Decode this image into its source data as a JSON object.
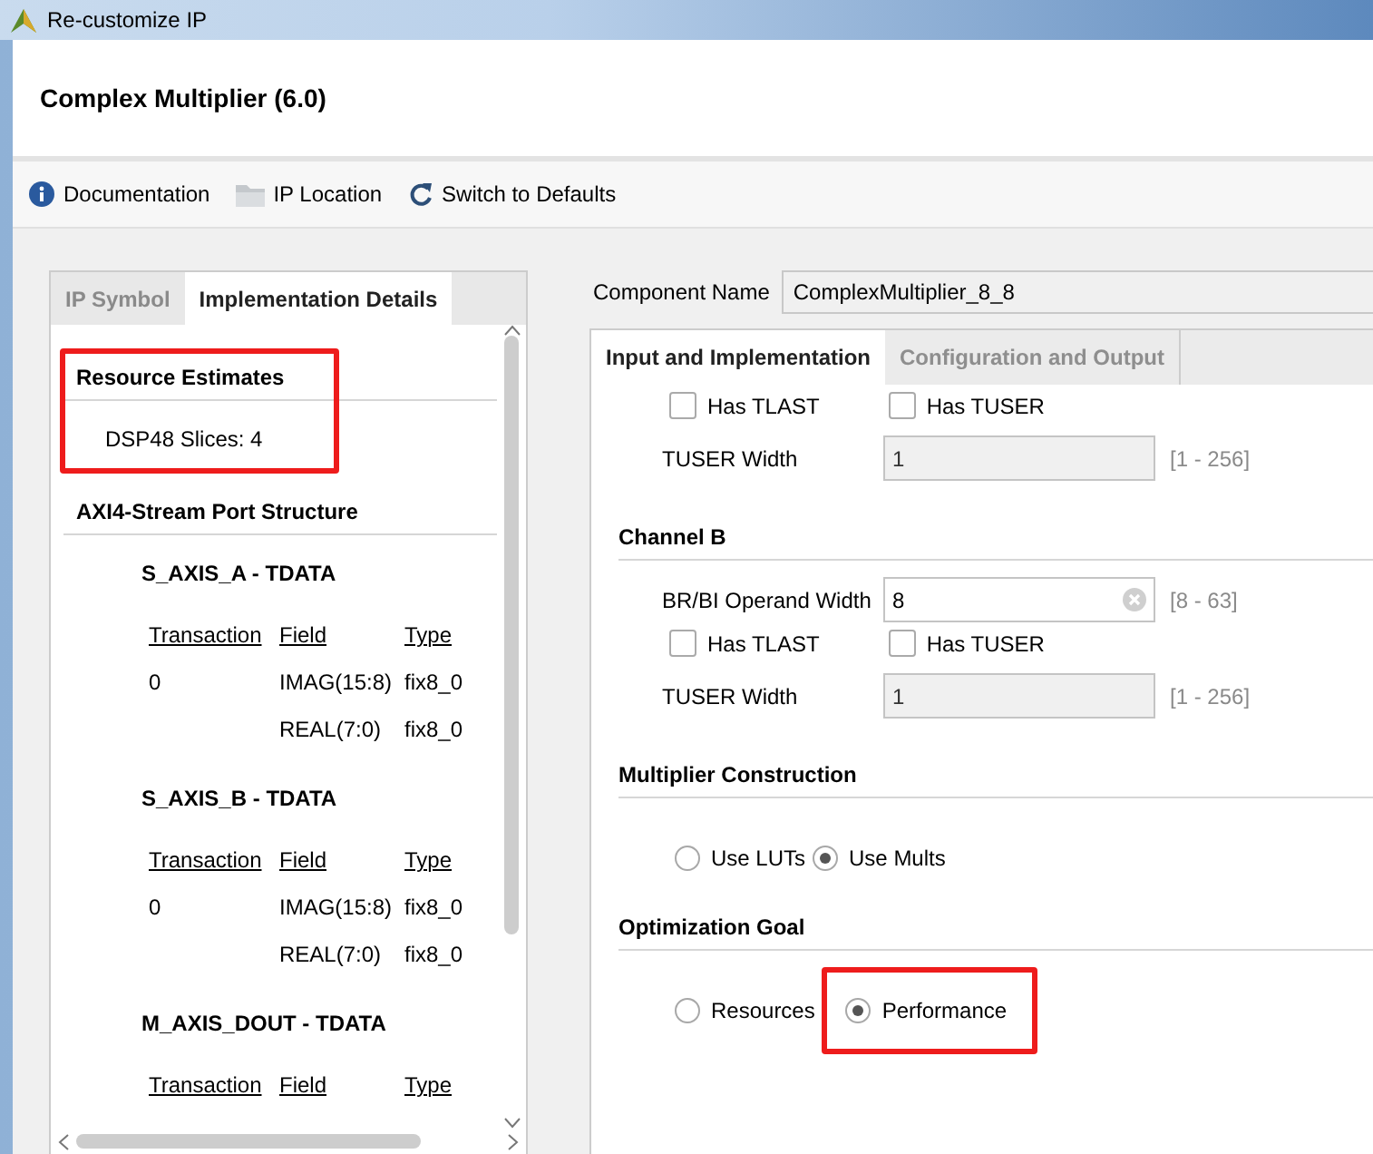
{
  "window": {
    "title": "Re-customize IP"
  },
  "header": {
    "title": "Complex Multiplier (6.0)"
  },
  "toolbar": [
    {
      "label": "Documentation",
      "kind": "info"
    },
    {
      "label": "IP Location",
      "kind": "folder"
    },
    {
      "label": "Switch to Defaults",
      "kind": "refresh"
    }
  ],
  "left_tabs": [
    {
      "label": "IP Symbol",
      "selected": false
    },
    {
      "label": "Implementation Details",
      "selected": true
    }
  ],
  "resource_estimates": {
    "title": "Resource Estimates",
    "text": "DSP48 Slices: 4",
    "highlighted": true
  },
  "port_structure": {
    "title": "AXI4-Stream Port Structure",
    "ports": [
      {
        "name": "S_AXIS_A - TDATA",
        "columns": [
          "Transaction",
          "Field",
          "Type"
        ],
        "rows": [
          {
            "transaction": "0",
            "field": "IMAG(15:8)",
            "type": "fix8_0"
          },
          {
            "field": "REAL(7:0)",
            "type": "fix8_0"
          }
        ]
      },
      {
        "name": "S_AXIS_B - TDATA",
        "columns": [
          "Transaction",
          "Field",
          "Type"
        ],
        "rows": [
          {
            "transaction": "0",
            "field": "IMAG(15:8)",
            "type": "fix8_0"
          },
          {
            "field": "REAL(7:0)",
            "type": "fix8_0"
          }
        ]
      },
      {
        "name": "M_AXIS_DOUT - TDATA",
        "columns": [
          "Transaction",
          "Field",
          "Type"
        ]
      }
    ]
  },
  "component_name": {
    "label": "Component Name",
    "value": "ComplexMultiplier_8_8"
  },
  "right_tabs": [
    {
      "label": "Input and Implementation",
      "selected": true
    },
    {
      "label": "Configuration and Output",
      "selected": false
    }
  ],
  "content": [
    {
      "kind": "checkboxes",
      "items": [
        {
          "label": "Has TLAST",
          "checked": false
        },
        {
          "label": "Has TUSER",
          "checked": false
        }
      ]
    },
    {
      "kind": "field",
      "label": "TUSER Width",
      "value": "1",
      "disabled": true,
      "range": "[1 - 256]"
    },
    {
      "kind": "heading",
      "title": "Channel B"
    },
    {
      "kind": "field",
      "label": "BR/BI Operand Width",
      "value": "8",
      "disabled": false,
      "clearable": true,
      "range": "[8 - 63]"
    },
    {
      "kind": "checkboxes",
      "items": [
        {
          "label": "Has TLAST",
          "checked": false
        },
        {
          "label": "Has TUSER",
          "checked": false
        }
      ]
    },
    {
      "kind": "field",
      "label": "TUSER Width",
      "value": "1",
      "disabled": true,
      "range": "[1 - 256]"
    },
    {
      "kind": "heading",
      "title": "Multiplier Construction"
    },
    {
      "kind": "radios",
      "items": [
        {
          "label": "Use LUTs",
          "selected": false
        },
        {
          "label": "Use Mults",
          "selected": true
        }
      ]
    },
    {
      "kind": "heading",
      "title": "Optimization Goal"
    },
    {
      "kind": "radios",
      "items": [
        {
          "label": "Resources",
          "selected": false
        },
        {
          "label": "Performance",
          "selected": true,
          "highlighted": true
        }
      ]
    }
  ]
}
